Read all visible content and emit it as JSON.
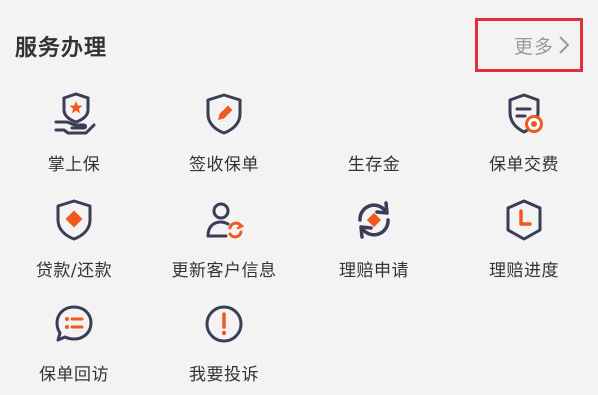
{
  "section": {
    "title": "服务办理",
    "more_label": "更多"
  },
  "services": [
    {
      "label": "掌上保",
      "icon": "hand-shield-icon"
    },
    {
      "label": "签收保单",
      "icon": "sign-shield-icon"
    },
    {
      "label": "生存金",
      "icon": ""
    },
    {
      "label": "保单交费",
      "icon": "policy-payment-icon"
    },
    {
      "label": "贷款/还款",
      "icon": "loan-shield-icon"
    },
    {
      "label": "更新客户信息",
      "icon": "update-user-icon"
    },
    {
      "label": "理赔申请",
      "icon": "claim-refresh-icon"
    },
    {
      "label": "理赔进度",
      "icon": "claim-clock-icon"
    },
    {
      "label": "保单回访",
      "icon": "chat-list-icon"
    },
    {
      "label": "我要投诉",
      "icon": "exclamation-icon"
    }
  ],
  "colors": {
    "accent": "#f05a1e",
    "icon_dark": "#3a3d55",
    "highlight_border": "#e0303a"
  }
}
